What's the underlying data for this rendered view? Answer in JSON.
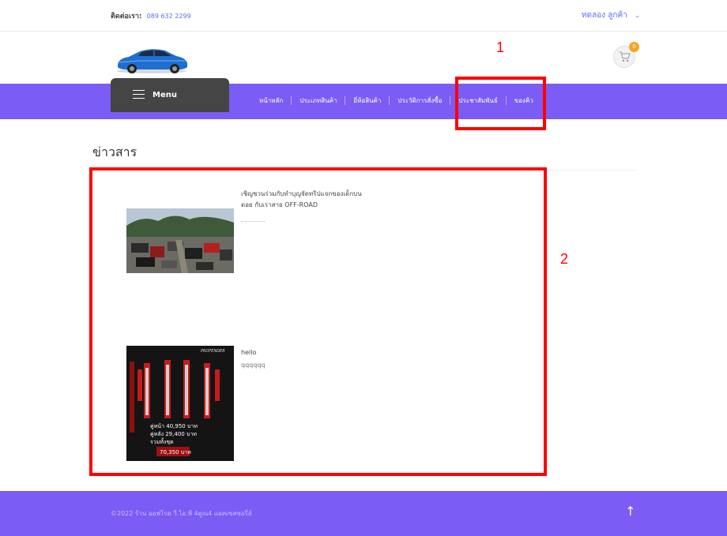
{
  "topbar": {
    "contact_label": "ติดต่อเรา:",
    "contact_phone": "089 632 2299",
    "trial_label": "ทดลอง ลูกค้า"
  },
  "cart": {
    "count": "0"
  },
  "menu": {
    "label": "Menu"
  },
  "nav": {
    "items": [
      "หน้าหลัก",
      "ประเภทสินค้า",
      "ยี่ห้อสินค้า",
      "ประวัติการสั่งซื้อ",
      "ประชาสัมพันธ์",
      "ของคิว"
    ]
  },
  "annotations": {
    "box1": "1",
    "box2": "2"
  },
  "section": {
    "title": "ข่าวสาร"
  },
  "news": [
    {
      "title_line1": "เชิญชวนร่วมกับทำบุญจัดทริปแจกของเด็กบน",
      "title_line2": "ดอย กับเราสาย OFF-ROAD",
      "desc": ""
    },
    {
      "title_line1": "hello",
      "title_line2": "",
      "desc": "qqqqqq",
      "image_text": {
        "brand": "PROFENDER",
        "front": "คู่หน้า  40,950  บาท",
        "rear": "คู่หลัง  29,400  บาท",
        "set": "รวมทั้งชุด",
        "total": "70,350 บาท"
      }
    }
  ],
  "footer": {
    "copyright": "©2022 ร้าน ออฟโรด วี.ไอ.พี 4ดูณ4 แอคเซสซอรี่ส์"
  },
  "colors": {
    "nav": "#7b5cf5",
    "menu": "#454545",
    "accent": "#5a6cff",
    "annotation": "#ff0000",
    "badge": "#f5a623"
  }
}
